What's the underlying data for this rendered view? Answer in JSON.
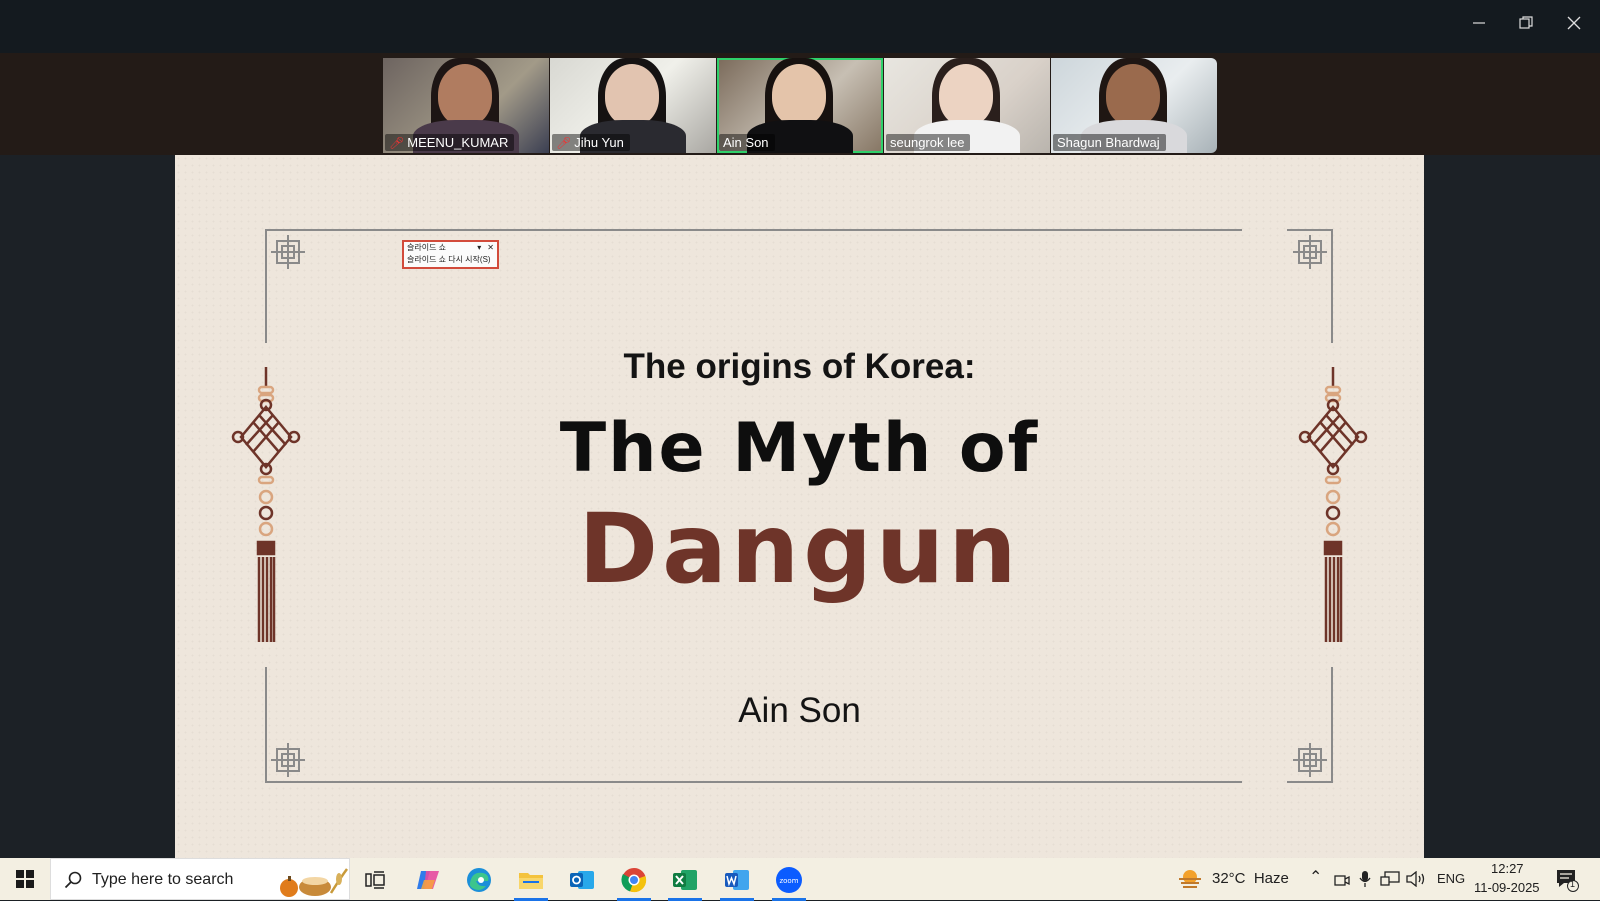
{
  "window": {
    "minimize_icon": "minimize-icon",
    "restore_icon": "restore-icon",
    "close_icon": "close-icon"
  },
  "participants": [
    {
      "name": "MEENU_KUMAR",
      "muted": true,
      "active": false
    },
    {
      "name": "Jihu Yun",
      "muted": true,
      "active": false
    },
    {
      "name": "Ain Son",
      "muted": false,
      "active": true
    },
    {
      "name": "seungrok lee",
      "muted": false,
      "active": false
    },
    {
      "name": "Shagun Bhardwaj",
      "muted": false,
      "active": false
    }
  ],
  "slide": {
    "subtitle": "The origins of Korea:",
    "title_line1": "The Myth of",
    "title_line2": "Dangun",
    "author": "Ain Son",
    "accent_color": "#6e3429"
  },
  "slideshow_popup": {
    "title": "슬라이드 쇼",
    "restart": "슬라이드 쇼 다시 시작(S)"
  },
  "taskbar": {
    "search_placeholder": "Type here to search",
    "weather": "32°C  Haze",
    "language": "ENG",
    "time": "12:27",
    "date": "11-09-2025",
    "notification_count": "1",
    "apps": [
      "task-view",
      "copilot",
      "edge",
      "file-explorer",
      "outlook",
      "chrome",
      "excel",
      "word",
      "zoom"
    ]
  }
}
